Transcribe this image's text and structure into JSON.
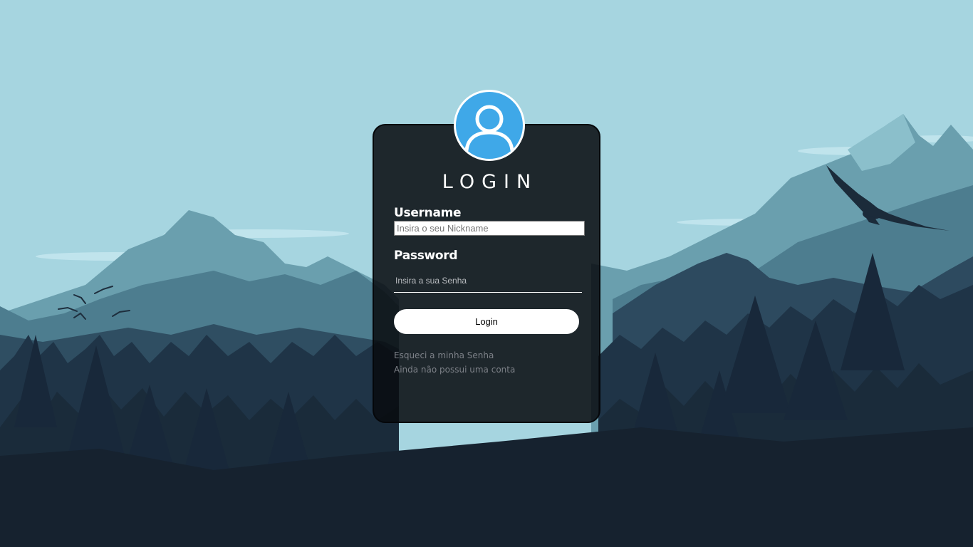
{
  "login_form": {
    "title": "LOGIN",
    "avatar_icon": "user-icon",
    "username_label": "Username",
    "username_placeholder": "Insira o seu Nickname",
    "username_value": "",
    "password_label": "Password",
    "password_placeholder": "Insira a sua Senha",
    "password_value": "",
    "login_button_label": "Login",
    "forgot_password_link": "Esqueci a minha Senha",
    "no_account_link": "Ainda não possui uma conta"
  },
  "colors": {
    "sky": "#a6d5e0",
    "avatar_background": "#3fa8e8",
    "card_background": "#080a0e",
    "link_text": "#7d8188"
  }
}
